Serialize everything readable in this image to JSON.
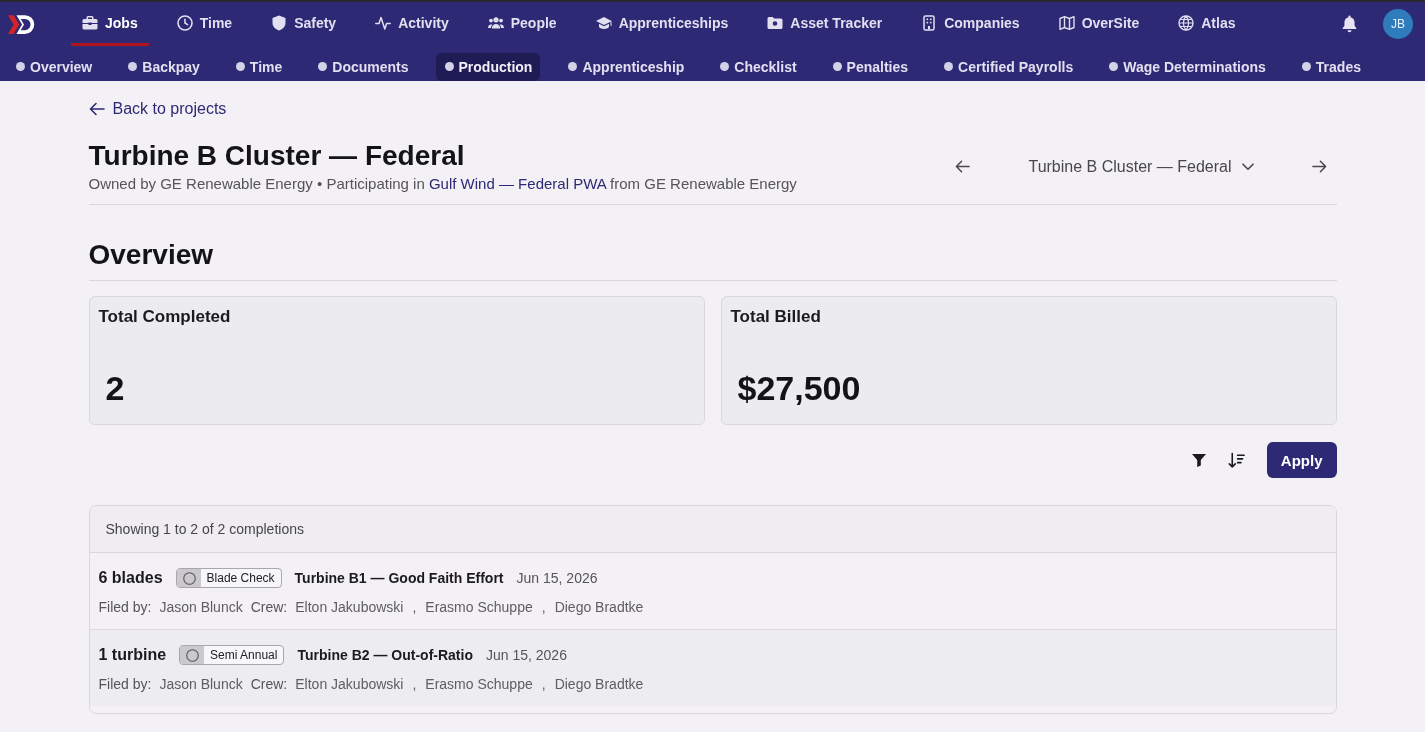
{
  "top_nav": {
    "items": [
      {
        "label": "Jobs",
        "selected": true
      },
      {
        "label": "Time",
        "selected": false
      },
      {
        "label": "Safety",
        "selected": false
      },
      {
        "label": "Activity",
        "selected": false
      },
      {
        "label": "People",
        "selected": false
      },
      {
        "label": "Apprenticeships",
        "selected": false
      },
      {
        "label": "Asset Tracker",
        "selected": false
      },
      {
        "label": "Companies",
        "selected": false
      },
      {
        "label": "OverSite",
        "selected": false
      },
      {
        "label": "Atlas",
        "selected": false
      }
    ],
    "avatar": "JB"
  },
  "sub_nav": {
    "items": [
      {
        "label": "Overview",
        "selected": false
      },
      {
        "label": "Backpay",
        "selected": false
      },
      {
        "label": "Time",
        "selected": false
      },
      {
        "label": "Documents",
        "selected": false
      },
      {
        "label": "Production",
        "selected": true
      },
      {
        "label": "Apprenticeship",
        "selected": false
      },
      {
        "label": "Checklist",
        "selected": false
      },
      {
        "label": "Penalties",
        "selected": false
      },
      {
        "label": "Certified Payrolls",
        "selected": false
      },
      {
        "label": "Wage Determinations",
        "selected": false
      },
      {
        "label": "Trades",
        "selected": false
      }
    ]
  },
  "back_link": "Back to projects",
  "project": {
    "title": "Turbine B Cluster — Federal",
    "subtitle": {
      "before": "Owned by GE Renewable Energy • Participating in",
      "link": "Gulf Wind — Federal PWA",
      "after": "from GE Renewable Energy"
    },
    "switcher": "Turbine B Cluster — Federal"
  },
  "overview": {
    "heading": "Overview",
    "stats": [
      {
        "label": "Total Completed",
        "value": "2"
      },
      {
        "label": "Total Billed",
        "value": "$27,500"
      }
    ]
  },
  "toolbar": {
    "apply_button": "Apply"
  },
  "completions": {
    "summary": "Showing 1 to 2 of 2 completions",
    "rows": [
      {
        "quantity": "6 blades",
        "type": "Blade Check",
        "title": "Turbine B1 — Good Faith Effort",
        "date": "Jun 15, 2026",
        "filed_by_label": "Filed by:",
        "filed_by": "Jason Blunck",
        "crew_label": "Crew:",
        "crew": [
          {
            "name": "Elton Jakubowski",
            "separator": ","
          },
          {
            "name": "Erasmo Schuppe",
            "separator": ","
          },
          {
            "name": "Diego Bradtke"
          }
        ]
      },
      {
        "quantity": "1 turbine",
        "type": "Semi Annual",
        "title": "Turbine B2 — Out-of-Ratio",
        "date": "Jun 15, 2026",
        "filed_by_label": "Filed by:",
        "filed_by": "Jason Blunck",
        "crew_label": "Crew:",
        "crew": [
          {
            "name": "Elton Jakubowski",
            "separator": ","
          },
          {
            "name": "Erasmo Schuppe",
            "separator": ","
          },
          {
            "name": "Diego Bradtke"
          }
        ]
      }
    ]
  }
}
